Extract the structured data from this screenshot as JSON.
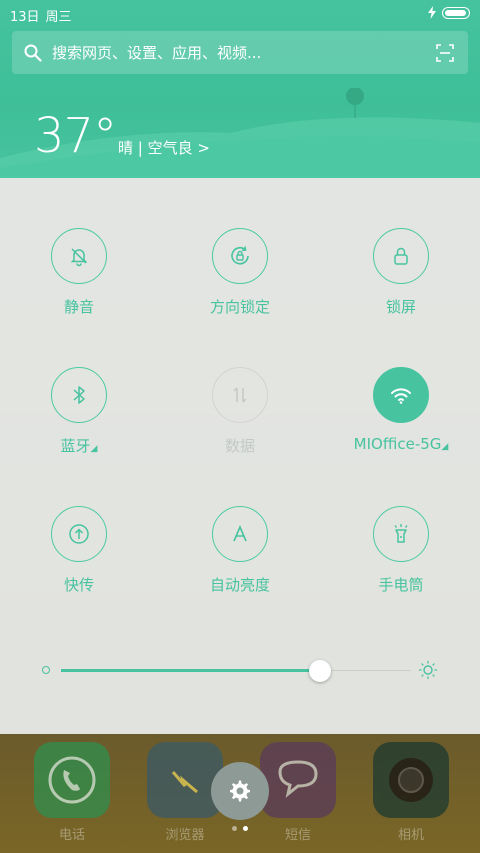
{
  "status_bar": {
    "date": "13日",
    "weekday": "周三"
  },
  "search": {
    "placeholder": "搜索网页、设置、应用、视频..."
  },
  "weather": {
    "temperature": "37°",
    "condition": "晴 | 空气良 >"
  },
  "quick_settings": [
    {
      "id": "mute",
      "label": "静音",
      "icon": "bell-off-icon",
      "state": "off"
    },
    {
      "id": "rotation-lock",
      "label": "方向锁定",
      "icon": "rotation-lock-icon",
      "state": "off"
    },
    {
      "id": "lock-screen",
      "label": "锁屏",
      "icon": "lock-icon",
      "state": "off"
    },
    {
      "id": "bluetooth",
      "label": "蓝牙",
      "icon": "bluetooth-icon",
      "state": "off",
      "has_more": true
    },
    {
      "id": "mobile-data",
      "label": "数据",
      "icon": "data-arrows-icon",
      "state": "disabled"
    },
    {
      "id": "wifi",
      "label": "MIOffice-5G",
      "icon": "wifi-icon",
      "state": "on",
      "has_more": true
    },
    {
      "id": "quick-share",
      "label": "快传",
      "icon": "upload-icon",
      "state": "off"
    },
    {
      "id": "auto-brightness",
      "label": "自动亮度",
      "icon": "auto-brightness-icon",
      "state": "off"
    },
    {
      "id": "flashlight",
      "label": "手电筒",
      "icon": "flashlight-icon",
      "state": "off"
    }
  ],
  "brightness": {
    "level": 0.74
  },
  "dock": {
    "apps": [
      {
        "label": "电话",
        "icon": "phone-icon"
      },
      {
        "label": "浏览器",
        "icon": "browser-icon"
      },
      {
        "label": "短信",
        "icon": "message-icon"
      },
      {
        "label": "相机",
        "icon": "camera-icon"
      }
    ]
  },
  "colors": {
    "accent": "#47c39f",
    "panel": "#ecedea"
  }
}
